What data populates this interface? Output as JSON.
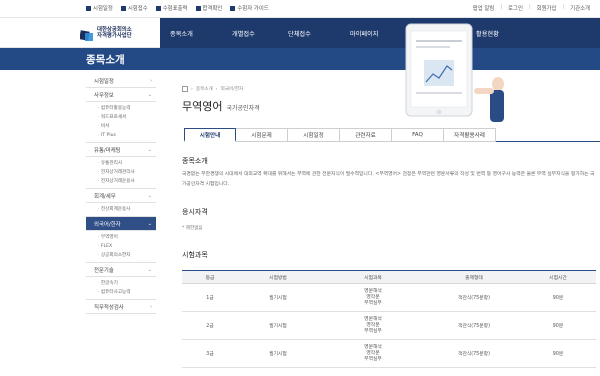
{
  "util_left": [
    {
      "label": "시험일정",
      "icon": "calendar-icon"
    },
    {
      "label": "시험접수",
      "icon": "pencil-icon"
    },
    {
      "label": "수험표출력",
      "icon": "print-icon"
    },
    {
      "label": "합격확인",
      "icon": "check-icon"
    },
    {
      "label": "수험자 가이드",
      "icon": "book-icon"
    }
  ],
  "util_right": [
    "팝업 알림",
    "로그인",
    "회원가입",
    "기관소개"
  ],
  "logo": {
    "line1": "대한상공회의소",
    "line2": "자격평가사업단"
  },
  "nav": [
    "종목소개",
    "개별접수",
    "단체접수",
    "마이페이지",
    "고객센터",
    "활용현황"
  ],
  "subhead_title": "종목소개",
  "sidebar": {
    "sections": [
      {
        "label": "시험일정",
        "active": false,
        "subs": []
      },
      {
        "label": "사무정보",
        "active": false,
        "subs": [
          "컴퓨터활용능력",
          "워드프로세서",
          "비서",
          "IT Plus"
        ]
      },
      {
        "label": "유통/마케팅",
        "active": false,
        "subs": [
          "유통관리사",
          "전자상거래관리사",
          "전자상거래운용사"
        ]
      },
      {
        "label": "회계/세무",
        "active": false,
        "subs": [
          "전산회계운용사"
        ]
      },
      {
        "label": "외국어/한자",
        "active": true,
        "subs": [
          "무역영어",
          "FLEX",
          "상공회의소한자"
        ]
      },
      {
        "label": "전문기술",
        "active": false,
        "subs": [
          "한글속기",
          "컴퓨터사고능력"
        ]
      },
      {
        "label": "직무적성검사",
        "active": false,
        "subs": []
      }
    ]
  },
  "breadcrumb": [
    "종목소개",
    "외국어/한자"
  ],
  "page_title": "무역영어",
  "page_subtitle": "국가공인자격",
  "tabs": [
    "시험안내",
    "시험문제",
    "시험일정",
    "관련자료",
    "FAQ",
    "자격활용사례"
  ],
  "active_tab": 0,
  "intro": {
    "title": "종목소개",
    "text": "국경없는 무한경쟁의 시대에서 대외교역 확대를 위해서는 무역에 관한 전문지식이 필수적입니다. <무역영어> 검정은 무역관련 영문서류의 작성 및 번역 등 영어구사 능력은 물론 무역 실무지식을 평가하는 국가공인자격 시험입니다."
  },
  "qualification": {
    "title": "응시자격",
    "note": "* 제한없음"
  },
  "subjects": {
    "title": "시험과목",
    "headers": [
      "등급",
      "시험방법",
      "시험과목",
      "출제형태",
      "시험시간"
    ],
    "rows": [
      {
        "grade": "1급",
        "method": "필기시험",
        "subjects": [
          "영문해석",
          "영작문",
          "무역실무"
        ],
        "format": "객관식(75문항)",
        "time": "90분"
      },
      {
        "grade": "2급",
        "method": "필기시험",
        "subjects": [
          "영문해석",
          "영작문",
          "무역실무"
        ],
        "format": "객관식(75문항)",
        "time": "90분"
      },
      {
        "grade": "3급",
        "method": "필기시험",
        "subjects": [
          "영문해석",
          "영작문",
          "무역실무"
        ],
        "format": "객관식(75문항)",
        "time": "90분"
      }
    ]
  },
  "colors": {
    "navy": "#1e3a6d",
    "subhead": "#244a86",
    "active": "#2f4f86"
  }
}
